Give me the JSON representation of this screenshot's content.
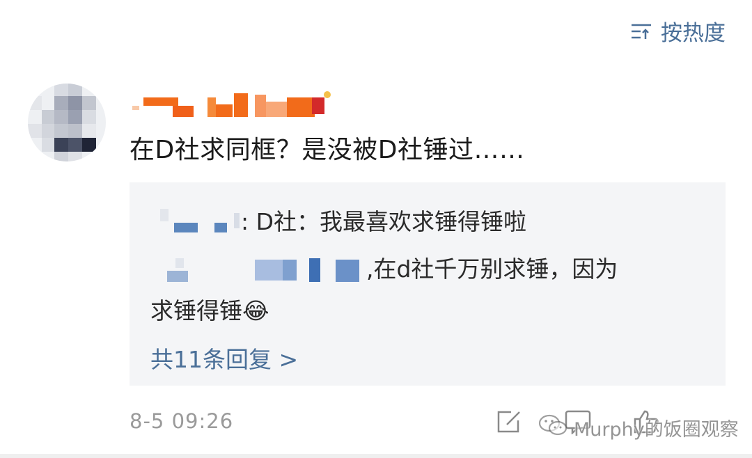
{
  "header": {
    "sort_label": "按热度",
    "sort_icon": "sort-lines-icon"
  },
  "comment": {
    "text": "在D社求同框？是没被D社锤过……",
    "timestamp": "8-5 09:26"
  },
  "replies": {
    "line1_text": ": D社：我最喜欢求锤得锤啦",
    "line2_text": ",在d社千万别求锤，因为",
    "line3_text": "求锤得锤",
    "emoji": "😂",
    "more_label": "共11条回复 >"
  },
  "actions": {
    "edit_icon": "share-edit-icon",
    "comment_icon": "comment-icon",
    "like_icon": "like-icon"
  },
  "watermark": {
    "text": "Murphy的饭圈观察",
    "icon": "wechat-icon"
  },
  "colors": {
    "link_blue": "#4a6f98",
    "reply_bg": "#f4f5f7",
    "muted": "#9a9a9a"
  }
}
